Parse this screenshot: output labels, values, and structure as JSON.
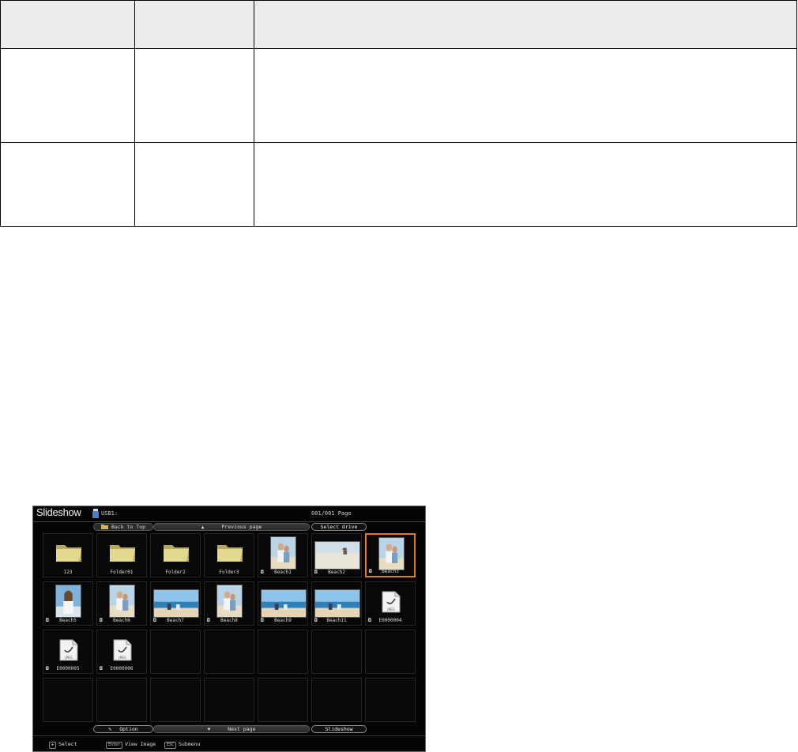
{
  "doc_table": {
    "headers": [
      "",
      "",
      ""
    ],
    "rows": [
      [
        "",
        "",
        ""
      ],
      [
        "",
        "",
        ""
      ]
    ]
  },
  "slideshow": {
    "title": "Slideshow",
    "drive_path": "USB1:",
    "page_indicator": "001/001 Page",
    "top_nav": {
      "back_to_top": "Back to Top",
      "previous_page": "Previous page",
      "select_drive": "Select drive"
    },
    "bottom_nav": {
      "option": "Option",
      "next_page": "Next page",
      "slideshow": "Slideshow"
    },
    "help": {
      "select": "Select",
      "enter_key": "Enter",
      "view_image": "View Image",
      "esc_key": "ESC",
      "submenu": "Submenu"
    },
    "colors": {
      "selection": "#e07a24",
      "background": "#050505",
      "folder": "#d9cf84"
    },
    "items": [
      {
        "type": "folder",
        "label": "123"
      },
      {
        "type": "folder",
        "label": "Folder01"
      },
      {
        "type": "folder",
        "label": "Folder2"
      },
      {
        "type": "folder",
        "label": "Folder3"
      },
      {
        "type": "image",
        "label": "Beach1",
        "orient": "portrait",
        "scene": "beach-couple"
      },
      {
        "type": "image",
        "label": "Beach2",
        "orient": "landscape",
        "scene": "beach-sand"
      },
      {
        "type": "image",
        "label": "Beach3",
        "orient": "portrait",
        "scene": "beach-couple",
        "selected": true
      },
      {
        "type": "image",
        "label": "Beach5",
        "orient": "portrait",
        "scene": "beach-woman"
      },
      {
        "type": "image",
        "label": "Beach6",
        "orient": "portrait",
        "scene": "beach-couple"
      },
      {
        "type": "image",
        "label": "Beach7",
        "orient": "landscape",
        "scene": "beach-sea"
      },
      {
        "type": "image",
        "label": "Beach8",
        "orient": "portrait",
        "scene": "beach-couple"
      },
      {
        "type": "image",
        "label": "Beach9",
        "orient": "landscape",
        "scene": "beach-sea"
      },
      {
        "type": "image",
        "label": "Beach11",
        "orient": "landscape",
        "scene": "beach-sea"
      },
      {
        "type": "jpeg",
        "label": "E0000004"
      },
      {
        "type": "jpeg",
        "label": "E0000005"
      },
      {
        "type": "jpeg",
        "label": "E0000006"
      }
    ],
    "total_slots": 28
  }
}
